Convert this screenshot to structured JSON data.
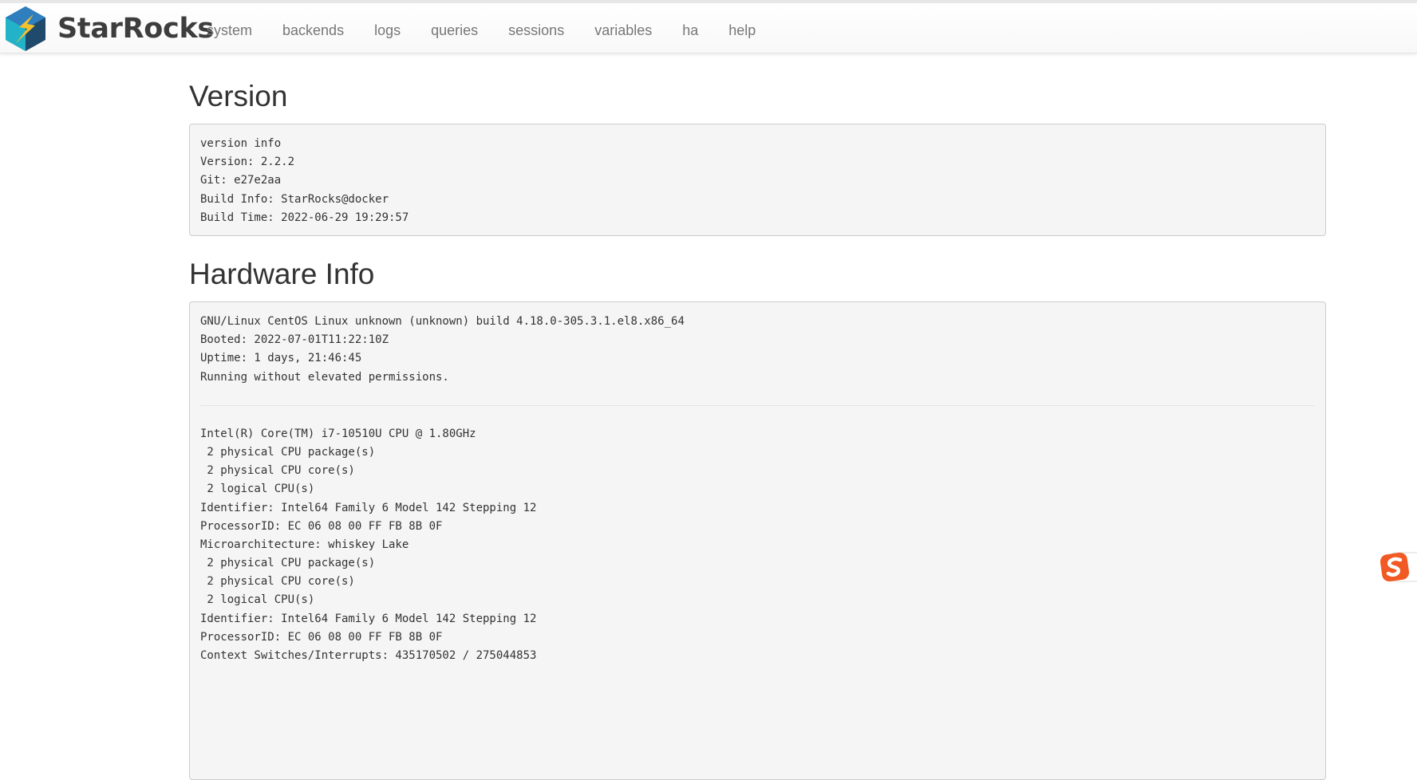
{
  "brand": {
    "name": "StarRocks",
    "colors": {
      "blue": "#2f7fbf",
      "teal": "#23b3c9",
      "yellow": "#f3c12d",
      "dark": "#1f4a6b"
    }
  },
  "nav": {
    "items": [
      {
        "label": "system"
      },
      {
        "label": "backends"
      },
      {
        "label": "logs"
      },
      {
        "label": "queries"
      },
      {
        "label": "sessions"
      },
      {
        "label": "variables"
      },
      {
        "label": "ha"
      },
      {
        "label": "help"
      }
    ]
  },
  "version_section": {
    "title": "Version",
    "lines": [
      "version info",
      "Version: 2.2.2",
      "Git: e27e2aa",
      "Build Info: StarRocks@docker",
      "Build Time: 2022-06-29 19:29:57"
    ]
  },
  "hardware_section": {
    "title": "Hardware Info",
    "os_lines": [
      "GNU/Linux CentOS Linux unknown (unknown) build 4.18.0-305.3.1.el8.x86_64",
      "Booted: 2022-07-01T11:22:10Z",
      "Uptime: 1 days, 21:46:45",
      "Running without elevated permissions."
    ],
    "cpu_lines": [
      "Intel(R) Core(TM) i7-10510U CPU @ 1.80GHz",
      " 2 physical CPU package(s)",
      " 2 physical CPU core(s)",
      " 2 logical CPU(s)",
      "Identifier: Intel64 Family 6 Model 142 Stepping 12",
      "ProcessorID: EC 06 08 00 FF FB 8B 0F",
      "Microarchitecture: whiskey Lake",
      " 2 physical CPU package(s)",
      " 2 physical CPU core(s)",
      " 2 logical CPU(s)",
      "Identifier: Intel64 Family 6 Model 142 Stepping 12",
      "ProcessorID: EC 06 08 00 FF FB 8B 0F",
      "Context Switches/Interrupts: 435170502 / 275044853"
    ]
  },
  "side_widget": {
    "icon": "sogou-ime-icon",
    "letter": "S",
    "color": "#f15a24"
  }
}
